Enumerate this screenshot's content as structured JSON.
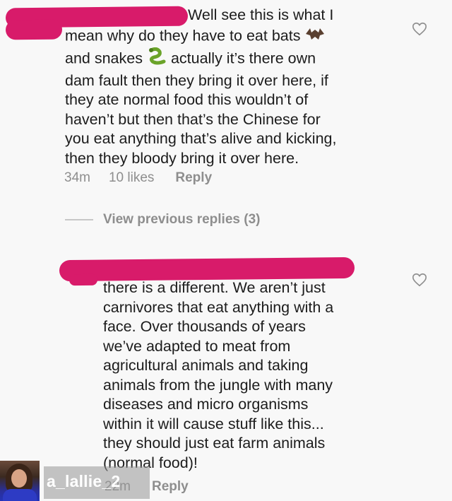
{
  "comments": [
    {
      "text_lines": [
        "Well see this is what I",
        "mean why do they have to eat bats",
        "and snakes",
        "actually it’s there own",
        "dam fault then they bring it over here, if",
        "they ate normal food this wouldn’t of",
        "haven’t but then that’s the Chinese for",
        "you eat anything that’s alive and kicking,",
        "then they bloody bring it over here."
      ],
      "emojis": [
        "bat-emoji",
        "snake-emoji"
      ],
      "time": "34m",
      "likes": "10 likes",
      "reply": "Reply"
    },
    {
      "text_lines": [
        "there is a different. We aren’t just",
        "carnivores that eat anything with a",
        "face. Over thousands of years",
        "we’ve adapted to meat from",
        "agricultural animals and taking",
        "animals from the jungle with many",
        "diseases and micro organisms",
        "within it will cause stuff like this...",
        "they should just eat farm animals",
        "(normal food)!"
      ],
      "time": "22m",
      "reply": "Reply"
    }
  ],
  "view_previous": "View previous replies (3)",
  "watermark": "a_lallie_2",
  "colors": {
    "redaction": "#d81b6a",
    "meta": "#8e8e8e"
  },
  "icons": [
    "heart-icon",
    "heart-icon"
  ]
}
